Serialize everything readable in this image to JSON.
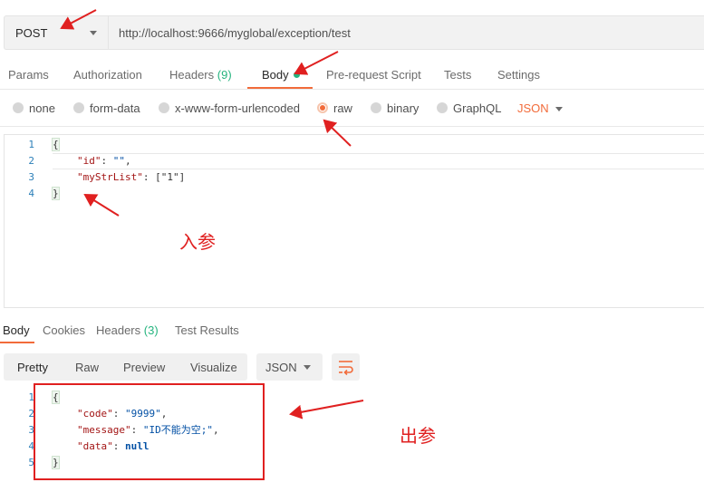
{
  "request": {
    "method": "POST",
    "url": "http://localhost:9666/myglobal/exception/test"
  },
  "request_tabs": {
    "params": "Params",
    "authorization": "Authorization",
    "headers": "Headers",
    "headers_count": "(9)",
    "body": "Body",
    "pre_request": "Pre-request Script",
    "tests": "Tests",
    "settings": "Settings"
  },
  "body_types": {
    "none": "none",
    "form_data": "form-data",
    "urlencoded": "x-www-form-urlencoded",
    "raw": "raw",
    "binary": "binary",
    "graphql": "GraphQL",
    "format": "JSON",
    "selected": "raw"
  },
  "request_body": {
    "line_numbers": [
      "1",
      "2",
      "3",
      "4"
    ],
    "open_brace": "{",
    "close_brace": "}",
    "id_key": "\"id\"",
    "id_value": "\"\"",
    "list_key": "\"myStrList\"",
    "list_value": "[\"1\"]",
    "colon": ": ",
    "comma": ","
  },
  "response_tabs": {
    "body": "Body",
    "cookies": "Cookies",
    "headers": "Headers",
    "headers_count": "(3)",
    "test_results": "Test Results"
  },
  "response_toolbar": {
    "pretty": "Pretty",
    "raw": "Raw",
    "preview": "Preview",
    "visualize": "Visualize",
    "format": "JSON"
  },
  "response_body": {
    "line_numbers": [
      "1",
      "2",
      "3",
      "4",
      "5"
    ],
    "open_brace": "{",
    "close_brace": "}",
    "code_key": "\"code\"",
    "code_value": "\"9999\"",
    "message_key": "\"message\"",
    "message_value": "\"ID不能为空;\"",
    "data_key": "\"data\"",
    "data_value": "null",
    "colon": ": ",
    "comma": ","
  },
  "annotations": {
    "input_label": "入参",
    "output_label": "出参"
  },
  "colors": {
    "accent": "#f26b3a",
    "count_green": "#26b47f",
    "annotation_red": "#e02020"
  }
}
